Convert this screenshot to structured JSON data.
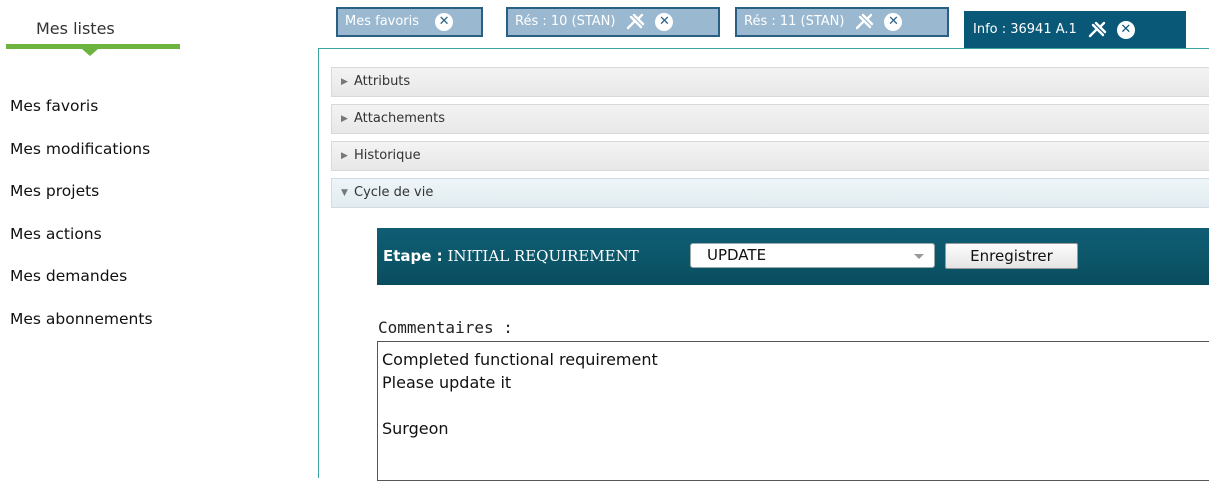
{
  "sidebar": {
    "title": "Mes listes",
    "items": [
      {
        "label": "Mes favoris"
      },
      {
        "label": "Mes modifications"
      },
      {
        "label": "Mes projets"
      },
      {
        "label": "Mes actions"
      },
      {
        "label": "Mes demandes"
      },
      {
        "label": "Mes abonnements"
      }
    ]
  },
  "tabs": [
    {
      "label": "Mes favoris",
      "pinned": false,
      "active": false
    },
    {
      "label": "Rés : 10 (STAN)",
      "pinned": true,
      "active": false
    },
    {
      "label": "Rés : 11 (STAN)",
      "pinned": true,
      "active": false
    },
    {
      "label": "Info : 36941 A.1",
      "pinned": true,
      "active": true
    }
  ],
  "accordion": [
    {
      "label": "Attributs",
      "open": false
    },
    {
      "label": "Attachements",
      "open": false
    },
    {
      "label": "Historique",
      "open": false
    },
    {
      "label": "Cycle de vie",
      "open": true
    }
  ],
  "lifecycle": {
    "etape_prefix": "Etape :",
    "etape_value": "INITIAL REQUIREMENT",
    "select_value": "UPDATE",
    "save_label": "Enregistrer"
  },
  "comments": {
    "label": "Commentaires :",
    "value": "Completed functional requirement\nPlease update it\n\nSurgeon"
  },
  "colors": {
    "accent_green": "#6db33f",
    "tab_inactive": "#9ab8cf",
    "tab_active": "#0a5878",
    "etape_bar": "#0c5568"
  }
}
